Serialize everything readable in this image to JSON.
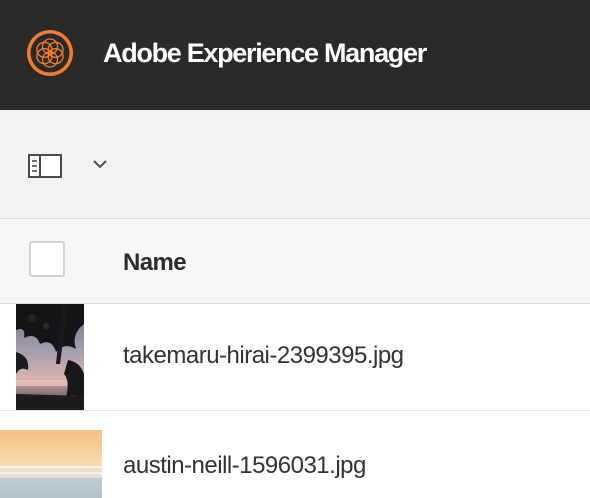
{
  "header": {
    "app_title": "Adobe Experience Manager",
    "logo_icon": "adobe-experience-manager-logo",
    "background": "#2a2a29",
    "accent": "#f07c31"
  },
  "toolbar": {
    "rail_toggle_icon": "rail-panel-icon",
    "dropdown_icon": "chevron-down-icon"
  },
  "list": {
    "columns": [
      {
        "label": "Name"
      }
    ],
    "rows": [
      {
        "file_name": "takemaru-hirai-2399395.jpg",
        "thumbnail": "tree-silhouette-sunset-photo"
      },
      {
        "file_name": "austin-neill-1596031.jpg",
        "thumbnail": "beach-sunset-photo"
      }
    ]
  }
}
